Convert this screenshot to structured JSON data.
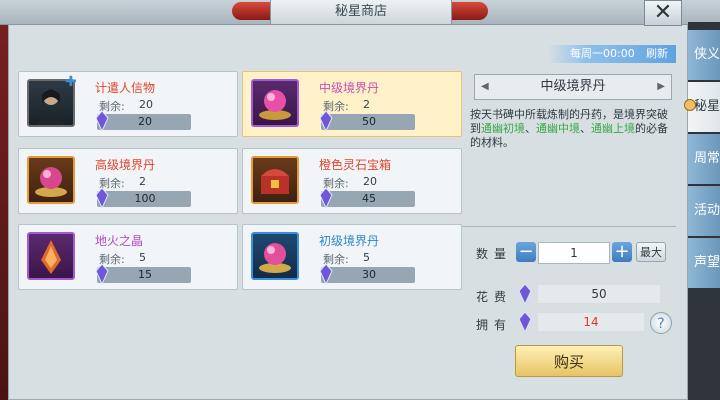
{
  "window": {
    "title": "秘星商店",
    "close_label": "✕"
  },
  "refresh": {
    "schedule": "每周一00:00",
    "label": "刷新"
  },
  "items": [
    {
      "name": "计遣人信物",
      "name_color": "#e0452f",
      "remain_label": "剩余:",
      "remain": "20",
      "price": "20",
      "icon": "portrait-icon",
      "frame": "#6b6b6b",
      "selected": false
    },
    {
      "name": "中级境界丹",
      "name_color": "#c94fb6",
      "remain_label": "剩余:",
      "remain": "2",
      "price": "50",
      "icon": "purple-elixir-icon",
      "frame": "#a45bd0",
      "selected": true
    },
    {
      "name": "高级境界丹",
      "name_color": "#e0452f",
      "remain_label": "剩余:",
      "remain": "2",
      "price": "100",
      "icon": "gold-elixir-icon",
      "frame": "#e29a3a",
      "selected": false
    },
    {
      "name": "橙色灵石宝箱",
      "name_color": "#e0452f",
      "remain_label": "剩余:",
      "remain": "20",
      "price": "45",
      "icon": "treasure-chest-icon",
      "frame": "#e29a3a",
      "selected": false
    },
    {
      "name": "地火之晶",
      "name_color": "#b04cc6",
      "remain_label": "剩余:",
      "remain": "5",
      "price": "15",
      "icon": "fire-crystal-icon",
      "frame": "#a45bd0",
      "selected": false
    },
    {
      "name": "初级境界丹",
      "name_color": "#2f86d0",
      "remain_label": "剩余:",
      "remain": "5",
      "price": "30",
      "icon": "blue-elixir-icon",
      "frame": "#3c8fd8",
      "selected": false
    }
  ],
  "detail": {
    "title": "中级境界丹",
    "desc_1": "按天书碑中所载炼制的丹药，是境界突破到",
    "desc_green_1": "通幽初境",
    "desc_sep_1": "、",
    "desc_green_2": "通幽中境",
    "desc_sep_2": "、",
    "desc_green_3": "通幽上境",
    "desc_2": "的必备的材料。",
    "qty_label": "数量",
    "qty_value": "1",
    "minus": "−",
    "plus": "+",
    "max_label": "最大",
    "cost_label": "花费",
    "cost_value": "50",
    "own_label": "拥有",
    "own_value": "14",
    "own_color": "#e03a2a",
    "help_label": "?",
    "buy_label": "购买"
  },
  "side_tabs": [
    {
      "label": "侠义",
      "active": false
    },
    {
      "label": "秘星",
      "active": true
    },
    {
      "label": "周常",
      "active": false
    },
    {
      "label": "活动",
      "active": false
    },
    {
      "label": "声望",
      "active": false
    }
  ],
  "colors": {
    "accent_blue": "#5fa2e0",
    "green_text": "#3aa64a",
    "red_text": "#e03a2a"
  }
}
